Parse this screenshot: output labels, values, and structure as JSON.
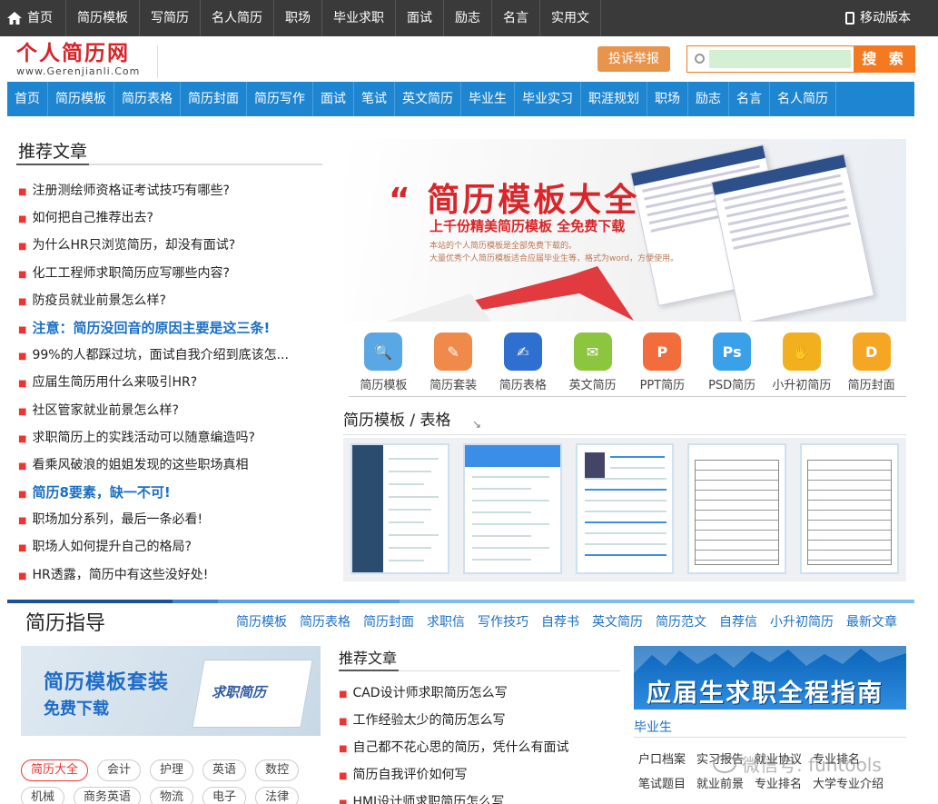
{
  "topbar": {
    "home": "首页",
    "items": [
      "简历模板",
      "写简历",
      "名人简历",
      "职场",
      "毕业求职",
      "面试",
      "励志",
      "名言",
      "实用文"
    ],
    "mobile": "移动版本"
  },
  "header": {
    "logo_title": "个人简历网",
    "logo_sub": "www.Gerenjianli.Com",
    "report_label": "投诉举报",
    "search_placeholder": "",
    "search_label": "搜 索"
  },
  "mainnav": [
    "首页",
    "简历模板",
    "简历表格",
    "简历封面",
    "简历写作",
    "面试",
    "笔试",
    "英文简历",
    "毕业生",
    "毕业实习",
    "职涯规划",
    "职场",
    "励志",
    "名言",
    "名人简历"
  ],
  "recommend": {
    "title": "推荐文章",
    "items": [
      {
        "text": "注册测绘师资格证考试技巧有哪些?",
        "hl": false
      },
      {
        "text": "如何把自己推荐出去?",
        "hl": false
      },
      {
        "text": "为什么HR只浏览简历，却没有面试?",
        "hl": false
      },
      {
        "text": "化工工程师求职简历应写哪些内容?",
        "hl": false
      },
      {
        "text": "防疫员就业前景怎么样?",
        "hl": false
      },
      {
        "text": "注意：简历没回音的原因主要是这三条!",
        "hl": true
      },
      {
        "text": "99%的人都踩过坑，面试自我介绍到底该怎...",
        "hl": false
      },
      {
        "text": "应届生简历用什么来吸引HR?",
        "hl": false
      },
      {
        "text": "社区管家就业前景怎么样?",
        "hl": false
      },
      {
        "text": "求职简历上的实践活动可以随意编造吗?",
        "hl": false
      },
      {
        "text": "看乘风破浪的姐姐发现的这些职场真相",
        "hl": false
      },
      {
        "text": "简历8要素，缺一不可!",
        "hl": true
      },
      {
        "text": "职场加分系列，最后一条必看!",
        "hl": false
      },
      {
        "text": "职场人如何提升自己的格局?",
        "hl": false
      },
      {
        "text": "HR透露，简历中有这些没好处!",
        "hl": false
      }
    ]
  },
  "banner": {
    "title": "“ 简历模板大全",
    "subtitle": "上千份精美简历模板 全免费下载",
    "desc1": "本站的个人简历模板是全部免费下载的。",
    "desc2": "大量优秀个人简历模板适合应届毕业生等，格式为word，方便使用。"
  },
  "icons": [
    {
      "label": "简历模板",
      "icon": "magnifier-doc-icon",
      "color": "#5aa7e6",
      "glyph": "🔍"
    },
    {
      "label": "简历套装",
      "icon": "doc-set-icon",
      "color": "#f08a4b",
      "glyph": "✎"
    },
    {
      "label": "简历表格",
      "icon": "table-pen-icon",
      "color": "#2f6fcf",
      "glyph": "✍"
    },
    {
      "label": "英文简历",
      "icon": "english-doc-icon",
      "color": "#8cc63f",
      "glyph": "✉"
    },
    {
      "label": "PPT简历",
      "icon": "ppt-icon",
      "color": "#f26c3c",
      "glyph": "P"
    },
    {
      "label": "PSD简历",
      "icon": "psd-icon",
      "color": "#3aa0e8",
      "glyph": "Ps"
    },
    {
      "label": "小升初简历",
      "icon": "hands-icon",
      "color": "#f2b01e",
      "glyph": "✋"
    },
    {
      "label": "简历封面",
      "icon": "cover-d-icon",
      "color": "#f5a623",
      "glyph": "D"
    }
  ],
  "templates": {
    "title": "简历模板 / 表格",
    "thumbs": [
      "sidebar",
      "bluetop",
      "photoleft",
      "grid",
      "grid2"
    ]
  },
  "divider_colors": [
    "#1e4f9a",
    "#3b83d8",
    "#5aa0e8",
    "#7dbcf0"
  ],
  "guide": {
    "title": "简历指导",
    "links": [
      "简历模板",
      "简历表格",
      "简历封面",
      "求职信",
      "写作技巧",
      "自荐书",
      "英文简历",
      "简历范文",
      "自荐信",
      "小升初简历",
      "最新文章"
    ]
  },
  "promo1": {
    "line1": "简历模板套装",
    "line2": "免费下载",
    "book_text": "求职简历"
  },
  "tags": {
    "row1": [
      {
        "text": "简历大全",
        "active": true
      },
      {
        "text": "会计",
        "active": false
      },
      {
        "text": "护理",
        "active": false
      },
      {
        "text": "英语",
        "active": false
      },
      {
        "text": "数控",
        "active": false
      }
    ],
    "row2": [
      {
        "text": "机械",
        "active": false
      },
      {
        "text": "商务英语",
        "active": false
      },
      {
        "text": "物流",
        "active": false
      },
      {
        "text": "电子",
        "active": false
      },
      {
        "text": "法律",
        "active": false
      }
    ]
  },
  "recommend2": {
    "title": "推荐文章",
    "items": [
      "CAD设计师求职简历怎么写",
      "工作经验太少的简历怎么写",
      "自己都不花心思的简历，凭什么有面试",
      "简历自我评价如何写",
      "HMI设计师求职简历怎么写"
    ]
  },
  "promo2": {
    "text": "应届生求职全程指南"
  },
  "graduate": {
    "tab": "毕业生",
    "links": [
      "户口档案",
      "实习报告",
      "就业协议",
      "专业排名",
      "笔试题目",
      "就业前景",
      "专业排名",
      "大学专业介绍"
    ]
  },
  "watermark": "微信号: funtools"
}
